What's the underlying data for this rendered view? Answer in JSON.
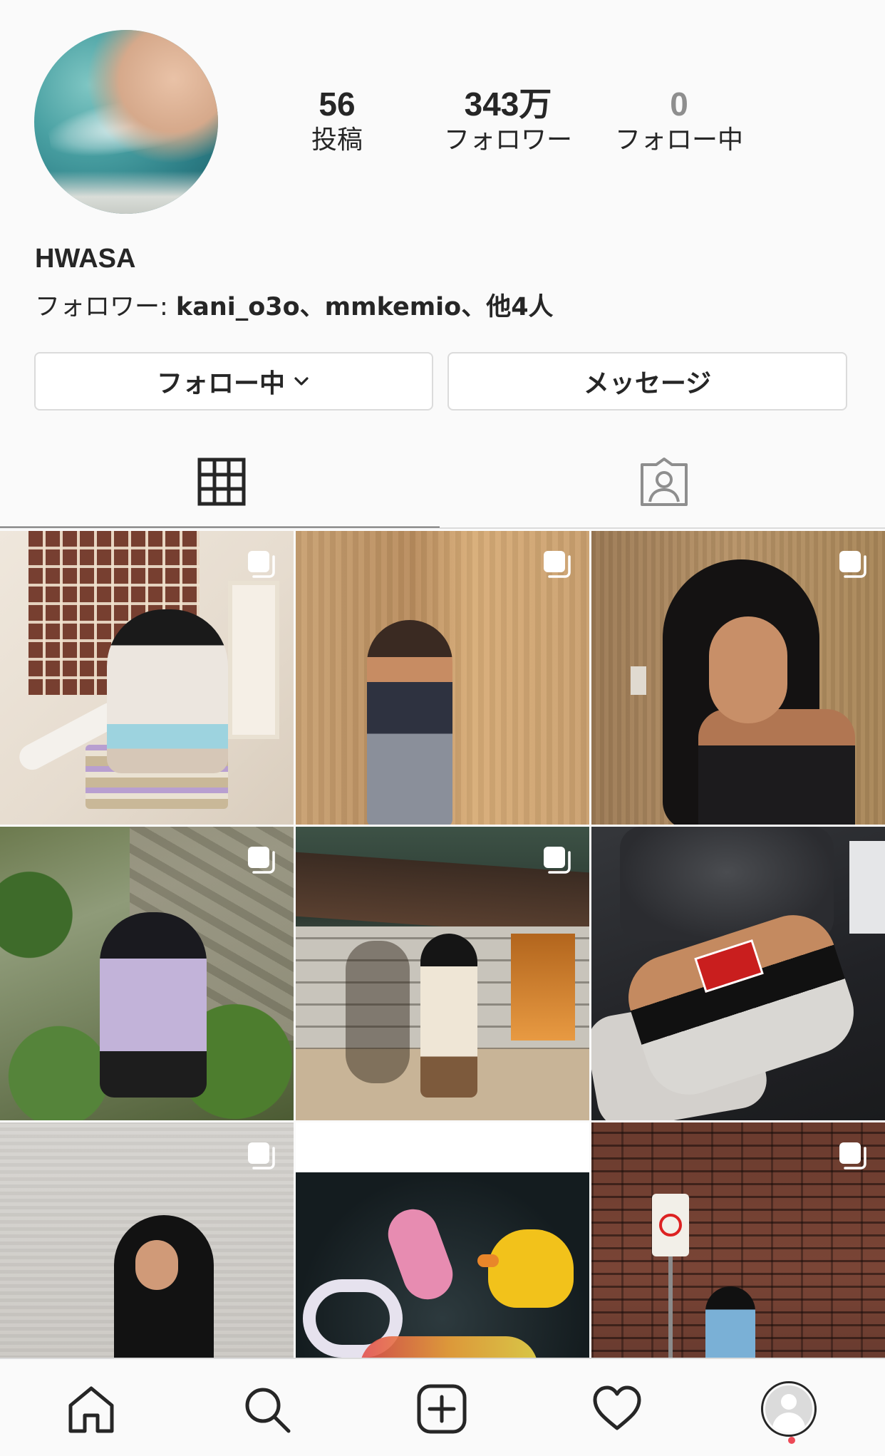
{
  "profile": {
    "username": "HWASA",
    "avatar_icon": "profile-photo"
  },
  "stats": [
    {
      "value": "56",
      "label": "投稿"
    },
    {
      "value": "343万",
      "label": "フォロワー"
    },
    {
      "value": "0",
      "label": "フォロー中"
    }
  ],
  "followers_line": {
    "prefix": "フォロワー: ",
    "names": "kani_o3o、mmkemio、他4人"
  },
  "buttons": {
    "following": "フォロー中",
    "message": "メッセージ"
  },
  "tabs": [
    {
      "name": "grid",
      "icon": "grid-icon",
      "active": true
    },
    {
      "name": "tagged",
      "icon": "tagged-user-icon",
      "active": false
    }
  ],
  "posts": [
    {
      "multiple": true
    },
    {
      "multiple": true
    },
    {
      "multiple": true
    },
    {
      "multiple": true
    },
    {
      "multiple": true
    },
    {
      "multiple": false
    },
    {
      "multiple": true
    },
    {
      "multiple": false
    },
    {
      "multiple": true
    }
  ],
  "bottom_nav": [
    "home-icon",
    "search-icon",
    "new-post-icon",
    "activity-heart-icon",
    "profile-icon"
  ],
  "colors": {
    "text": "#262626",
    "border": "#dbdbdb",
    "background": "#fafafa",
    "notification_dot": "#ed4956"
  }
}
